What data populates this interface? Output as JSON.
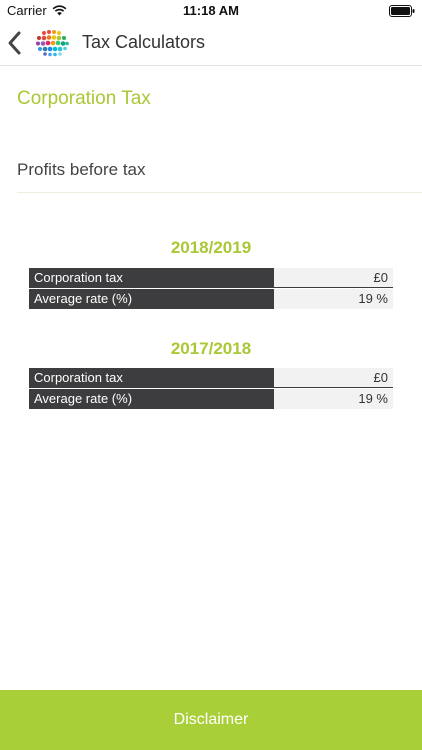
{
  "status_bar": {
    "carrier": "Carrier",
    "time": "11:18 AM"
  },
  "nav": {
    "title": "Tax Calculators",
    "back_icon": "chevron-left-icon",
    "logo_icon": "colored-dots-globe-logo"
  },
  "page": {
    "heading": "Corporation Tax"
  },
  "input": {
    "placeholder": "Profits before tax",
    "value": ""
  },
  "results": [
    {
      "year": "2018/2019",
      "rows": [
        {
          "label": "Corporation tax",
          "value": "£0"
        },
        {
          "label": "Average rate (%)",
          "value": "19 %"
        }
      ]
    },
    {
      "year": "2017/2018",
      "rows": [
        {
          "label": "Corporation tax",
          "value": "£0"
        },
        {
          "label": "Average rate (%)",
          "value": "19 %"
        }
      ]
    }
  ],
  "footer": {
    "disclaimer_label": "Disclaimer"
  },
  "colors": {
    "accent_green": "#a9c835",
    "footer_green": "#a9cf38",
    "label_dark": "#3d3d3f",
    "value_bg": "#f2f2f2"
  }
}
